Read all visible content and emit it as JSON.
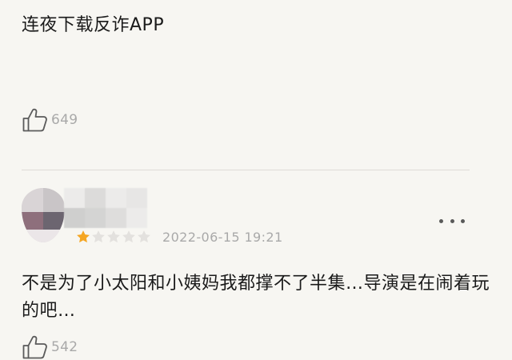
{
  "reviews": [
    {
      "text": "连夜下载反诈APP",
      "like_icon": "thumbs-up-icon",
      "like_count": "649"
    },
    {
      "avatar_colors": [
        "#d9d4d6",
        "#c9c5c7",
        "#8e6f7c",
        "#6c6570"
      ],
      "username_blur_colors": [
        "#ecebea",
        "#dcdbda",
        "#ecebea",
        "#e7e6e5",
        "#cfcfce",
        "#d4d4d3",
        "#dedddc",
        "#ecebea"
      ],
      "rating": {
        "filled": 1,
        "total": 5,
        "filled_color": "#f5a623",
        "empty_color": "#e3e1de"
      },
      "date": "2022-06-15 19:21",
      "more_icon": "more-horizontal-icon",
      "text": "不是为了小太阳和小姨妈我都撑不了半集…导演是在闹着玩的吧…",
      "like_icon": "thumbs-up-icon",
      "like_count": "542"
    }
  ]
}
